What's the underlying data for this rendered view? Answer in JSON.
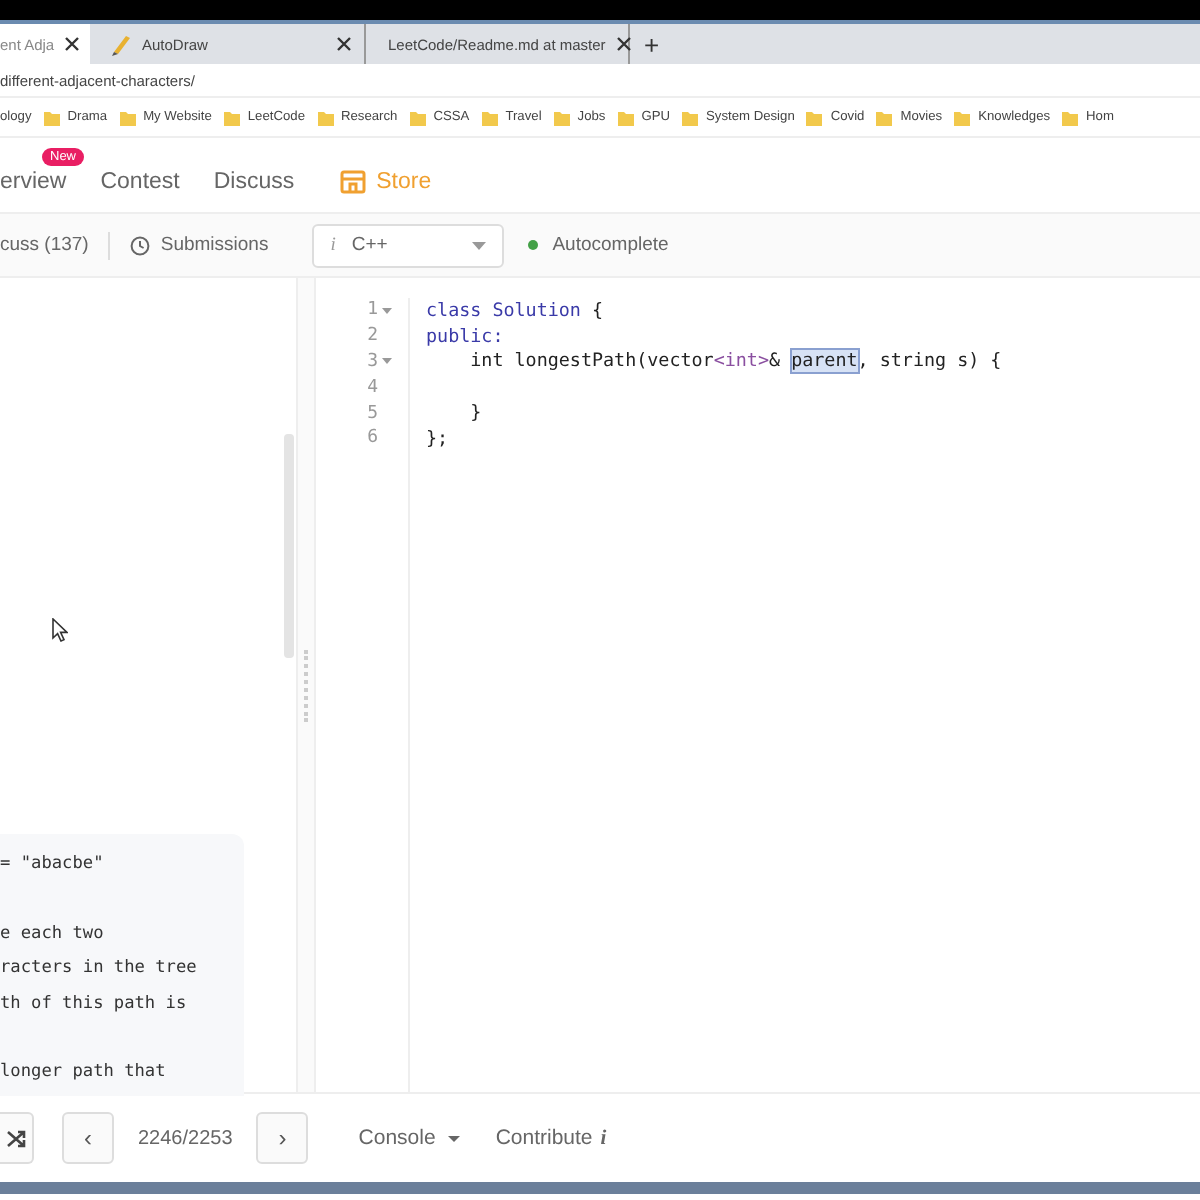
{
  "browser": {
    "tabs": [
      {
        "title": "ent Adja",
        "selected": true
      },
      {
        "title": "AutoDraw",
        "selected": false
      },
      {
        "title": "LeetCode/Readme.md at master",
        "selected": false
      }
    ],
    "new_tab": "+",
    "address": "different-adjacent-characters/",
    "bookmarks": [
      "ology",
      "Drama",
      "My Website",
      "LeetCode",
      "Research",
      "CSSA",
      "Travel",
      "Jobs",
      "GPU",
      "System Design",
      "Covid",
      "Movies",
      "Knowledges",
      "Hom"
    ]
  },
  "nav": {
    "items": [
      {
        "label": "erview",
        "badge": "New",
        "kind": "plain"
      },
      {
        "label": "Contest",
        "kind": "plain"
      },
      {
        "label": "Discuss",
        "kind": "plain"
      },
      {
        "label": "Store",
        "kind": "store"
      }
    ]
  },
  "toolbar": {
    "discuss": "cuss (137)",
    "submissions": "Submissions",
    "language": {
      "info": "i",
      "value": "C++"
    },
    "autocomplete": {
      "label": "Autocomplete",
      "on": true
    }
  },
  "description": {
    "paragraphs": [
      [
        "= \"abacbe\""
      ],
      [
        "e each two",
        "racters in the tree",
        "th of this path is"
      ],
      [
        "longer path that"
      ]
    ]
  },
  "editor": {
    "lines": [
      {
        "number": "1",
        "foldable": true,
        "tokens": [
          {
            "text": "class Solution",
            "kind": "keyword"
          },
          {
            "text": " {",
            "kind": "plain"
          }
        ]
      },
      {
        "number": "2",
        "foldable": false,
        "tokens": [
          {
            "text": "public:",
            "kind": "keyword"
          }
        ]
      },
      {
        "number": "3",
        "foldable": true,
        "tokens": [
          {
            "text": "    int longestPath(vector",
            "kind": "plain"
          },
          {
            "text": "<int>",
            "kind": "type"
          },
          {
            "text": "& ",
            "kind": "plain"
          },
          {
            "text": "parent",
            "kind": "selected"
          },
          {
            "text": ", string s) {",
            "kind": "plain"
          }
        ]
      },
      {
        "number": "4",
        "foldable": false
      },
      {
        "number": "5",
        "foldable": false,
        "tokens": [
          {
            "text": "    }",
            "kind": "plain"
          }
        ]
      },
      {
        "number": "6",
        "foldable": false,
        "tokens": [
          {
            "text": "};",
            "kind": "plain"
          }
        ]
      }
    ]
  },
  "footer": {
    "prev": "‹",
    "counter": "2246/2253",
    "next": "›",
    "console": "Console",
    "contribute": "Contribute",
    "contribute_info": "i"
  }
}
